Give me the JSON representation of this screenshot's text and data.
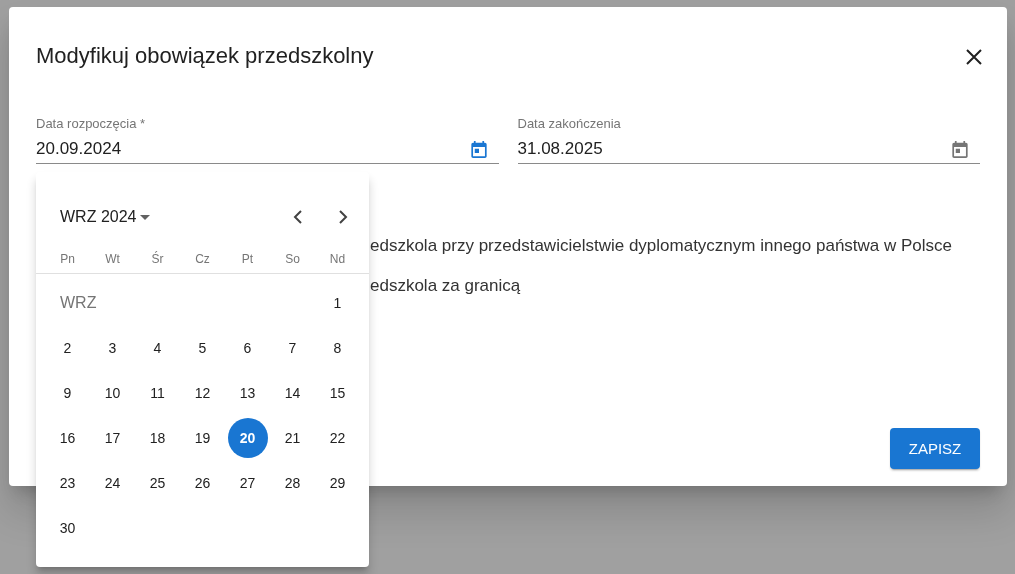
{
  "dialog": {
    "title": "Modyfikuj obowiązek przedszkolny",
    "fields": [
      {
        "label": "Data rozpoczęcia *",
        "value": "20.09.2024",
        "focused": true
      },
      {
        "label": "Data zakończenia",
        "value": "31.08.2025",
        "focused": false
      }
    ],
    "options": [
      "edszkola przy przedstawicielstwie dyplomatycznym innego państwa w Polsce",
      "edszkola za granicą"
    ],
    "save_button": "ZAPISZ"
  },
  "calendar": {
    "month_year": "WRZ 2024",
    "weekdays": [
      "Pn",
      "Wt",
      "Śr",
      "Cz",
      "Pt",
      "So",
      "Nd"
    ],
    "weeks": [
      {
        "month_label": "WRZ",
        "days": [
          {
            "day": "1",
            "selected": false
          }
        ]
      },
      {
        "days": [
          {
            "day": "2",
            "selected": false
          },
          {
            "day": "3",
            "selected": false
          },
          {
            "day": "4",
            "selected": false
          },
          {
            "day": "5",
            "selected": false
          },
          {
            "day": "6",
            "selected": false
          },
          {
            "day": "7",
            "selected": false
          },
          {
            "day": "8",
            "selected": false
          }
        ]
      },
      {
        "days": [
          {
            "day": "9",
            "selected": false
          },
          {
            "day": "10",
            "selected": false
          },
          {
            "day": "11",
            "selected": false
          },
          {
            "day": "12",
            "selected": false
          },
          {
            "day": "13",
            "selected": false
          },
          {
            "day": "14",
            "selected": false
          },
          {
            "day": "15",
            "selected": false
          }
        ]
      },
      {
        "days": [
          {
            "day": "16",
            "selected": false
          },
          {
            "day": "17",
            "selected": false
          },
          {
            "day": "18",
            "selected": false
          },
          {
            "day": "19",
            "selected": false
          },
          {
            "day": "20",
            "selected": true
          },
          {
            "day": "21",
            "selected": false
          },
          {
            "day": "22",
            "selected": false
          }
        ]
      },
      {
        "days": [
          {
            "day": "23",
            "selected": false
          },
          {
            "day": "24",
            "selected": false
          },
          {
            "day": "25",
            "selected": false
          },
          {
            "day": "26",
            "selected": false
          },
          {
            "day": "27",
            "selected": false
          },
          {
            "day": "28",
            "selected": false
          },
          {
            "day": "29",
            "selected": false
          }
        ]
      },
      {
        "days": [
          {
            "day": "30",
            "selected": false
          }
        ]
      }
    ]
  }
}
